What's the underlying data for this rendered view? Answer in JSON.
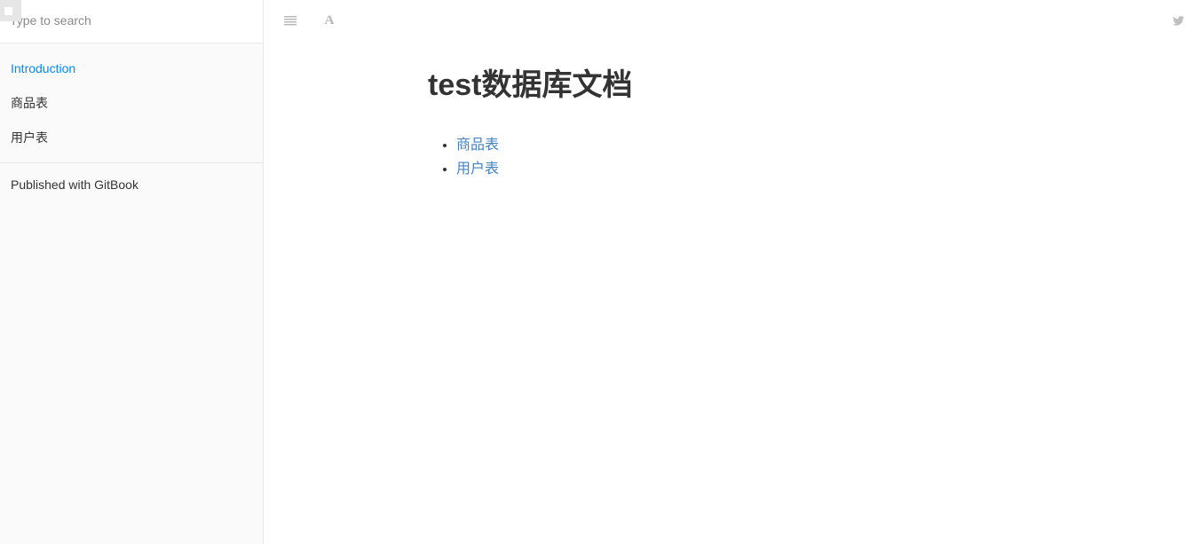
{
  "sidebar": {
    "search": {
      "placeholder": "Type to search",
      "value": ""
    },
    "items": [
      {
        "label": "Introduction",
        "active": true
      },
      {
        "label": "商品表",
        "active": false
      },
      {
        "label": "用户表",
        "active": false
      }
    ],
    "footer_link": "Published with GitBook"
  },
  "toolbar": {
    "icons": [
      "menu-toggle-icon",
      "font-settings-icon",
      "twitter-icon"
    ],
    "font_button_glyph": "A"
  },
  "page": {
    "title": "test数据库文档",
    "links": [
      "商品表",
      "用户表"
    ]
  },
  "colors": {
    "accent": "#008cff",
    "link": "#4183c4",
    "icon": "#b8b8b8",
    "sidebar_bg": "#fafafa",
    "border": "#e8e8e8",
    "text": "#333333"
  }
}
